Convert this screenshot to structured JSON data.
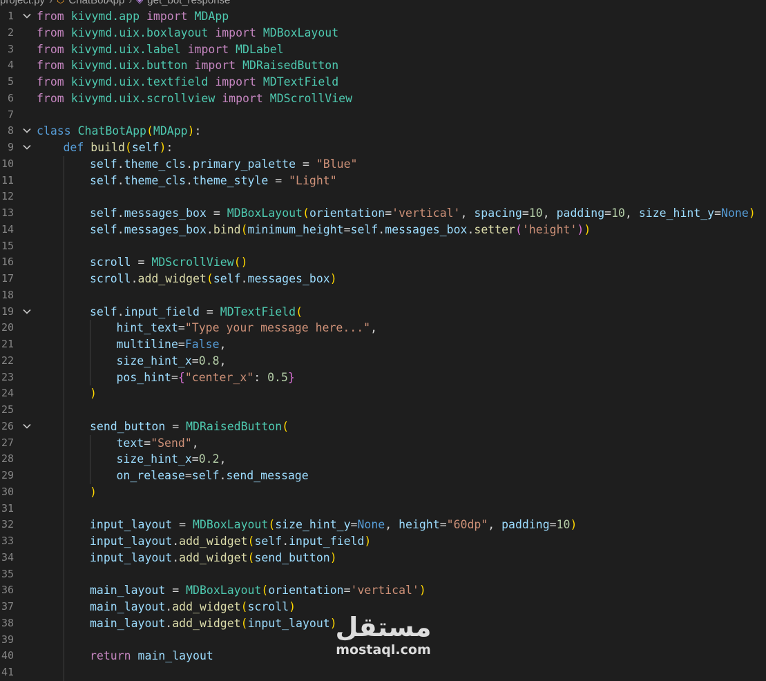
{
  "breadcrumb": {
    "file": "project.py",
    "class": "ChatBotApp",
    "method": "get_bot_response",
    "class_icon": "class-icon",
    "method_icon": "method-icon"
  },
  "editor": {
    "language": "python",
    "lines": [
      {
        "n": "1",
        "fold": true,
        "indent": 0,
        "tokens": [
          [
            "kw",
            "from"
          ],
          [
            "op",
            " "
          ],
          [
            "mod",
            "kivymd.app"
          ],
          [
            "op",
            " "
          ],
          [
            "kw",
            "import"
          ],
          [
            "op",
            " "
          ],
          [
            "cls",
            "MDApp"
          ]
        ]
      },
      {
        "n": "2",
        "fold": false,
        "indent": 0,
        "tokens": [
          [
            "kw",
            "from"
          ],
          [
            "op",
            " "
          ],
          [
            "mod",
            "kivymd.uix.boxlayout"
          ],
          [
            "op",
            " "
          ],
          [
            "kw",
            "import"
          ],
          [
            "op",
            " "
          ],
          [
            "cls",
            "MDBoxLayout"
          ]
        ]
      },
      {
        "n": "3",
        "fold": false,
        "indent": 0,
        "tokens": [
          [
            "kw",
            "from"
          ],
          [
            "op",
            " "
          ],
          [
            "mod",
            "kivymd.uix.label"
          ],
          [
            "op",
            " "
          ],
          [
            "kw",
            "import"
          ],
          [
            "op",
            " "
          ],
          [
            "cls",
            "MDLabel"
          ]
        ]
      },
      {
        "n": "4",
        "fold": false,
        "indent": 0,
        "tokens": [
          [
            "kw",
            "from"
          ],
          [
            "op",
            " "
          ],
          [
            "mod",
            "kivymd.uix.button"
          ],
          [
            "op",
            " "
          ],
          [
            "kw",
            "import"
          ],
          [
            "op",
            " "
          ],
          [
            "cls",
            "MDRaisedButton"
          ]
        ]
      },
      {
        "n": "5",
        "fold": false,
        "indent": 0,
        "tokens": [
          [
            "kw",
            "from"
          ],
          [
            "op",
            " "
          ],
          [
            "mod",
            "kivymd.uix.textfield"
          ],
          [
            "op",
            " "
          ],
          [
            "kw",
            "import"
          ],
          [
            "op",
            " "
          ],
          [
            "cls",
            "MDTextField"
          ]
        ]
      },
      {
        "n": "6",
        "fold": false,
        "indent": 0,
        "tokens": [
          [
            "kw",
            "from"
          ],
          [
            "op",
            " "
          ],
          [
            "mod",
            "kivymd.uix.scrollview"
          ],
          [
            "op",
            " "
          ],
          [
            "kw",
            "import"
          ],
          [
            "op",
            " "
          ],
          [
            "cls",
            "MDScrollView"
          ]
        ]
      },
      {
        "n": "7",
        "fold": false,
        "indent": 0,
        "tokens": []
      },
      {
        "n": "8",
        "fold": true,
        "indent": 0,
        "tokens": [
          [
            "kw2",
            "class"
          ],
          [
            "op",
            " "
          ],
          [
            "cls",
            "ChatBotApp"
          ],
          [
            "p1",
            "("
          ],
          [
            "cls",
            "MDApp"
          ],
          [
            "p1",
            ")"
          ],
          [
            "op",
            ":"
          ]
        ]
      },
      {
        "n": "9",
        "fold": true,
        "indent": 1,
        "tokens": [
          [
            "kw2",
            "def"
          ],
          [
            "op",
            " "
          ],
          [
            "fn",
            "build"
          ],
          [
            "p1",
            "("
          ],
          [
            "var",
            "self"
          ],
          [
            "p1",
            ")"
          ],
          [
            "op",
            ":"
          ]
        ]
      },
      {
        "n": "10",
        "fold": false,
        "indent": 2,
        "tokens": [
          [
            "var",
            "self"
          ],
          [
            "op",
            "."
          ],
          [
            "var",
            "theme_cls"
          ],
          [
            "op",
            "."
          ],
          [
            "var",
            "primary_palette"
          ],
          [
            "op",
            " = "
          ],
          [
            "str",
            "\"Blue\""
          ]
        ]
      },
      {
        "n": "11",
        "fold": false,
        "indent": 2,
        "tokens": [
          [
            "var",
            "self"
          ],
          [
            "op",
            "."
          ],
          [
            "var",
            "theme_cls"
          ],
          [
            "op",
            "."
          ],
          [
            "var",
            "theme_style"
          ],
          [
            "op",
            " = "
          ],
          [
            "str",
            "\"Light\""
          ]
        ]
      },
      {
        "n": "12",
        "fold": false,
        "indent": 2,
        "tokens": []
      },
      {
        "n": "13",
        "fold": false,
        "indent": 2,
        "tokens": [
          [
            "var",
            "self"
          ],
          [
            "op",
            "."
          ],
          [
            "var",
            "messages_box"
          ],
          [
            "op",
            " = "
          ],
          [
            "cls",
            "MDBoxLayout"
          ],
          [
            "p1",
            "("
          ],
          [
            "var",
            "orientation"
          ],
          [
            "op",
            "="
          ],
          [
            "str",
            "'vertical'"
          ],
          [
            "op",
            ", "
          ],
          [
            "var",
            "spacing"
          ],
          [
            "op",
            "="
          ],
          [
            "num",
            "10"
          ],
          [
            "op",
            ", "
          ],
          [
            "var",
            "padding"
          ],
          [
            "op",
            "="
          ],
          [
            "num",
            "10"
          ],
          [
            "op",
            ", "
          ],
          [
            "var",
            "size_hint_y"
          ],
          [
            "op",
            "="
          ],
          [
            "kw2",
            "None"
          ],
          [
            "p1",
            ")"
          ]
        ]
      },
      {
        "n": "14",
        "fold": false,
        "indent": 2,
        "tokens": [
          [
            "var",
            "self"
          ],
          [
            "op",
            "."
          ],
          [
            "var",
            "messages_box"
          ],
          [
            "op",
            "."
          ],
          [
            "fn",
            "bind"
          ],
          [
            "p1",
            "("
          ],
          [
            "var",
            "minimum_height"
          ],
          [
            "op",
            "="
          ],
          [
            "var",
            "self"
          ],
          [
            "op",
            "."
          ],
          [
            "var",
            "messages_box"
          ],
          [
            "op",
            "."
          ],
          [
            "fn",
            "setter"
          ],
          [
            "p2",
            "("
          ],
          [
            "str",
            "'height'"
          ],
          [
            "p2",
            ")"
          ],
          [
            "p1",
            ")"
          ]
        ]
      },
      {
        "n": "15",
        "fold": false,
        "indent": 2,
        "tokens": []
      },
      {
        "n": "16",
        "fold": false,
        "indent": 2,
        "tokens": [
          [
            "var",
            "scroll"
          ],
          [
            "op",
            " = "
          ],
          [
            "cls",
            "MDScrollView"
          ],
          [
            "p1",
            "()"
          ]
        ]
      },
      {
        "n": "17",
        "fold": false,
        "indent": 2,
        "tokens": [
          [
            "var",
            "scroll"
          ],
          [
            "op",
            "."
          ],
          [
            "fn",
            "add_widget"
          ],
          [
            "p1",
            "("
          ],
          [
            "var",
            "self"
          ],
          [
            "op",
            "."
          ],
          [
            "var",
            "messages_box"
          ],
          [
            "p1",
            ")"
          ]
        ]
      },
      {
        "n": "18",
        "fold": false,
        "indent": 2,
        "tokens": []
      },
      {
        "n": "19",
        "fold": true,
        "indent": 2,
        "tokens": [
          [
            "var",
            "self"
          ],
          [
            "op",
            "."
          ],
          [
            "var",
            "input_field"
          ],
          [
            "op",
            " = "
          ],
          [
            "cls",
            "MDTextField"
          ],
          [
            "p1",
            "("
          ]
        ]
      },
      {
        "n": "20",
        "fold": false,
        "indent": 3,
        "tokens": [
          [
            "var",
            "hint_text"
          ],
          [
            "op",
            "="
          ],
          [
            "str",
            "\"Type your message here...\""
          ],
          [
            "op",
            ","
          ]
        ]
      },
      {
        "n": "21",
        "fold": false,
        "indent": 3,
        "tokens": [
          [
            "var",
            "multiline"
          ],
          [
            "op",
            "="
          ],
          [
            "kw2",
            "False"
          ],
          [
            "op",
            ","
          ]
        ]
      },
      {
        "n": "22",
        "fold": false,
        "indent": 3,
        "tokens": [
          [
            "var",
            "size_hint_x"
          ],
          [
            "op",
            "="
          ],
          [
            "num",
            "0.8"
          ],
          [
            "op",
            ","
          ]
        ]
      },
      {
        "n": "23",
        "fold": false,
        "indent": 3,
        "tokens": [
          [
            "var",
            "pos_hint"
          ],
          [
            "op",
            "="
          ],
          [
            "p2",
            "{"
          ],
          [
            "str",
            "\"center_x\""
          ],
          [
            "op",
            ": "
          ],
          [
            "num",
            "0.5"
          ],
          [
            "p2",
            "}"
          ]
        ]
      },
      {
        "n": "24",
        "fold": false,
        "indent": 2,
        "tokens": [
          [
            "p1",
            ")"
          ]
        ]
      },
      {
        "n": "25",
        "fold": false,
        "indent": 2,
        "tokens": []
      },
      {
        "n": "26",
        "fold": true,
        "indent": 2,
        "tokens": [
          [
            "var",
            "send_button"
          ],
          [
            "op",
            " = "
          ],
          [
            "cls",
            "MDRaisedButton"
          ],
          [
            "p1",
            "("
          ]
        ]
      },
      {
        "n": "27",
        "fold": false,
        "indent": 3,
        "tokens": [
          [
            "var",
            "text"
          ],
          [
            "op",
            "="
          ],
          [
            "str",
            "\"Send\""
          ],
          [
            "op",
            ","
          ]
        ]
      },
      {
        "n": "28",
        "fold": false,
        "indent": 3,
        "tokens": [
          [
            "var",
            "size_hint_x"
          ],
          [
            "op",
            "="
          ],
          [
            "num",
            "0.2"
          ],
          [
            "op",
            ","
          ]
        ]
      },
      {
        "n": "29",
        "fold": false,
        "indent": 3,
        "tokens": [
          [
            "var",
            "on_release"
          ],
          [
            "op",
            "="
          ],
          [
            "var",
            "self"
          ],
          [
            "op",
            "."
          ],
          [
            "var",
            "send_message"
          ]
        ]
      },
      {
        "n": "30",
        "fold": false,
        "indent": 2,
        "tokens": [
          [
            "p1",
            ")"
          ]
        ]
      },
      {
        "n": "31",
        "fold": false,
        "indent": 2,
        "tokens": []
      },
      {
        "n": "32",
        "fold": false,
        "indent": 2,
        "tokens": [
          [
            "var",
            "input_layout"
          ],
          [
            "op",
            " = "
          ],
          [
            "cls",
            "MDBoxLayout"
          ],
          [
            "p1",
            "("
          ],
          [
            "var",
            "size_hint_y"
          ],
          [
            "op",
            "="
          ],
          [
            "kw2",
            "None"
          ],
          [
            "op",
            ", "
          ],
          [
            "var",
            "height"
          ],
          [
            "op",
            "="
          ],
          [
            "str",
            "\"60dp\""
          ],
          [
            "op",
            ", "
          ],
          [
            "var",
            "padding"
          ],
          [
            "op",
            "="
          ],
          [
            "num",
            "10"
          ],
          [
            "p1",
            ")"
          ]
        ]
      },
      {
        "n": "33",
        "fold": false,
        "indent": 2,
        "tokens": [
          [
            "var",
            "input_layout"
          ],
          [
            "op",
            "."
          ],
          [
            "fn",
            "add_widget"
          ],
          [
            "p1",
            "("
          ],
          [
            "var",
            "self"
          ],
          [
            "op",
            "."
          ],
          [
            "var",
            "input_field"
          ],
          [
            "p1",
            ")"
          ]
        ]
      },
      {
        "n": "34",
        "fold": false,
        "indent": 2,
        "tokens": [
          [
            "var",
            "input_layout"
          ],
          [
            "op",
            "."
          ],
          [
            "fn",
            "add_widget"
          ],
          [
            "p1",
            "("
          ],
          [
            "var",
            "send_button"
          ],
          [
            "p1",
            ")"
          ]
        ]
      },
      {
        "n": "35",
        "fold": false,
        "indent": 2,
        "tokens": []
      },
      {
        "n": "36",
        "fold": false,
        "indent": 2,
        "tokens": [
          [
            "var",
            "main_layout"
          ],
          [
            "op",
            " = "
          ],
          [
            "cls",
            "MDBoxLayout"
          ],
          [
            "p1",
            "("
          ],
          [
            "var",
            "orientation"
          ],
          [
            "op",
            "="
          ],
          [
            "str",
            "'vertical'"
          ],
          [
            "p1",
            ")"
          ]
        ]
      },
      {
        "n": "37",
        "fold": false,
        "indent": 2,
        "tokens": [
          [
            "var",
            "main_layout"
          ],
          [
            "op",
            "."
          ],
          [
            "fn",
            "add_widget"
          ],
          [
            "p1",
            "("
          ],
          [
            "var",
            "scroll"
          ],
          [
            "p1",
            ")"
          ]
        ]
      },
      {
        "n": "38",
        "fold": false,
        "indent": 2,
        "tokens": [
          [
            "var",
            "main_layout"
          ],
          [
            "op",
            "."
          ],
          [
            "fn",
            "add_widget"
          ],
          [
            "p1",
            "("
          ],
          [
            "var",
            "input_layout"
          ],
          [
            "p1",
            ")"
          ]
        ]
      },
      {
        "n": "39",
        "fold": false,
        "indent": 2,
        "tokens": []
      },
      {
        "n": "40",
        "fold": false,
        "indent": 2,
        "tokens": [
          [
            "kw",
            "return"
          ],
          [
            "op",
            " "
          ],
          [
            "var",
            "main_layout"
          ]
        ]
      },
      {
        "n": "41",
        "fold": false,
        "indent": 2,
        "tokens": []
      }
    ]
  },
  "watermark": {
    "arabic": "مستقل",
    "latin": "mostaql.com"
  },
  "colors": {
    "background": "#1e1e1e",
    "keyword": "#c586c0",
    "keyword_blue": "#569cd6",
    "class": "#4ec9b0",
    "function": "#dcdcaa",
    "variable": "#9cdcfe",
    "string": "#ce9178",
    "number": "#b5cea8"
  }
}
